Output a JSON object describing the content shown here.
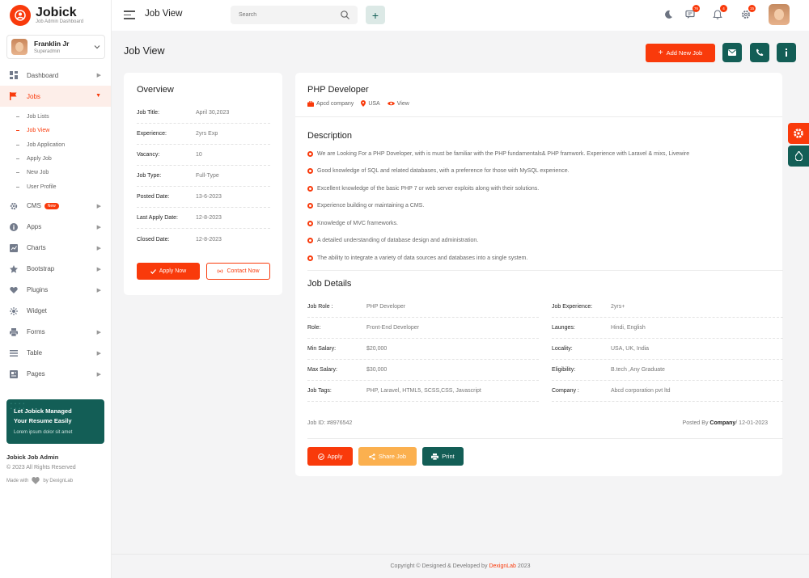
{
  "brand": {
    "name": "Jobick",
    "tagline": "Job Admin Dashboard",
    "accent": "#f93a0b",
    "secondary": "#135e56"
  },
  "user": {
    "name": "Franklin Jr",
    "role": "Superadmin"
  },
  "menu": {
    "dashboard": "Dashboard",
    "jobs": "Jobs",
    "jobs_sub": [
      "Job Lists",
      "Job View",
      "Job Application",
      "Apply Job",
      "New Job",
      "User Profile"
    ],
    "cms": "CMS",
    "new_badge": "New",
    "apps": "Apps",
    "charts": "Charts",
    "bootstrap": "Bootstrap",
    "plugins": "Plugins",
    "widget": "Widget",
    "forms": "Forms",
    "table": "Table",
    "pages": "Pages"
  },
  "promo": {
    "line1": "Let Jobick Managed",
    "line2": "Your Resume Easily",
    "sub": "Lorem ipsum dolor sit amet"
  },
  "sidebar_footer": {
    "title": "Jobick Job Admin",
    "copy": "© 2023 All Rights Reserved",
    "made_with": "Made with",
    "by": "by DexignLab"
  },
  "topbar": {
    "title": "Job View",
    "search_placeholder": "Search",
    "messages_count": "76",
    "notifications_count": "4",
    "settings_count": "15"
  },
  "page": {
    "title": "Job View",
    "add_button": "Add New Job"
  },
  "overview": {
    "title": "Overview",
    "rows": [
      {
        "k": "Job Title:",
        "v": "April 30,2023"
      },
      {
        "k": "Experience:",
        "v": "2yrs Exp"
      },
      {
        "k": "Vacancy:",
        "v": "10"
      },
      {
        "k": "Job Type:",
        "v": "Full-Type"
      },
      {
        "k": "Posted Date:",
        "v": "13-6-2023"
      },
      {
        "k": "Last Apply Date:",
        "v": "12-8-2023"
      },
      {
        "k": "Closed Date:",
        "v": "12-8-2023"
      }
    ],
    "apply_btn": "Apply Now",
    "contact_btn": "Contact Now"
  },
  "job": {
    "title": "PHP Developer",
    "company": "Apcd company",
    "location": "USA",
    "view": "View",
    "description_title": "Description",
    "description": [
      "We are Looking For a PHP Doveloper, with is must be familiar with the PHP fundamentals& PHP framwork. Experience with Laravel & mixs, Livewire",
      "Good knowledge of SQL and related databases, with a preference for those with MySQL experience.",
      "Excellent knowledge of the basic PHP 7 or web server exploits along with their solutions.",
      "Experience building or maintaining a CMS.",
      "Knowledge of MVC frameworks.",
      "A detailed understanding of database design and administration.",
      "The ability to integrate a variety of data sources and databases into a single system."
    ],
    "details_title": "Job Details",
    "details_left": [
      {
        "k": "Job Role :",
        "v": "PHP Developer"
      },
      {
        "k": "Role:",
        "v": "Front-End Developer"
      },
      {
        "k": "Min Salary:",
        "v": "$20,000"
      },
      {
        "k": "Max Salary:",
        "v": "$30,000"
      },
      {
        "k": "Job Tags:",
        "v": "PHP, Laravel, HTML5, SCSS,CSS, Javascript"
      }
    ],
    "details_right": [
      {
        "k": "Job Experience:",
        "v": "2yrs+"
      },
      {
        "k": "Launges:",
        "v": "Hindi, English"
      },
      {
        "k": "Locality:",
        "v": "USA, UK, India"
      },
      {
        "k": "Eligibility:",
        "v": "B.tech ,Any Graduate"
      },
      {
        "k": "Company :",
        "v": "Abcd corporation pvt ltd"
      }
    ],
    "job_id": "Job ID: #8976542",
    "posted_by_prefix": "Posted By ",
    "posted_by_company": "Company",
    "posted_by_date": "/ 12-01-2023",
    "apply_btn": "Apply",
    "share_btn": "Share Job",
    "print_btn": "Print"
  },
  "footer": {
    "prefix": "Copyright © Designed & Developed by",
    "brand": "DexignLab",
    "year": "2023"
  }
}
